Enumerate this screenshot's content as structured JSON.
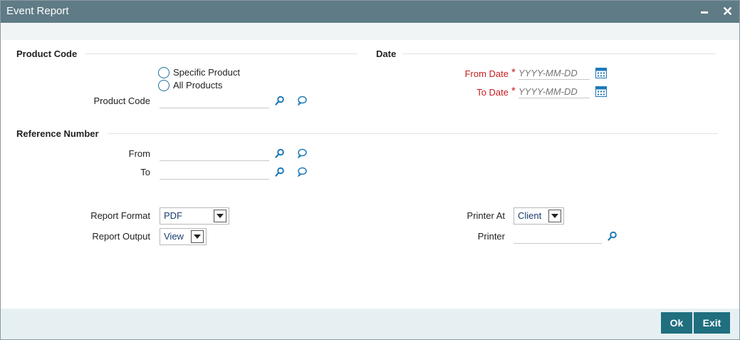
{
  "window": {
    "title": "Event Report"
  },
  "product_section": {
    "title": "Product Code",
    "radio_specific": "Specific Product",
    "radio_all": "All Products",
    "product_code_label": "Product Code"
  },
  "date_section": {
    "title": "Date",
    "from_label": "From Date",
    "to_label": "To Date",
    "required_mark": "*",
    "date_placeholder": "YYYY-MM-DD"
  },
  "reference_section": {
    "title": "Reference Number",
    "from_label": "From",
    "to_label": "To"
  },
  "report": {
    "format_label": "Report Format",
    "format_value": "PDF",
    "output_label": "Report Output",
    "output_value": "View",
    "printer_at_label": "Printer At",
    "printer_at_value": "Client",
    "printer_label": "Printer"
  },
  "buttons": {
    "ok": "Ok",
    "exit": "Exit"
  },
  "colors": {
    "titlebar": "#5f7b86",
    "accent": "#1f6f7f",
    "required": "#c31f1f",
    "icon": "#1e7ab8"
  },
  "icons": [
    "search-icon",
    "comment-icon",
    "calendar-icon",
    "minimize-icon",
    "close-icon",
    "chevron-down-icon"
  ]
}
